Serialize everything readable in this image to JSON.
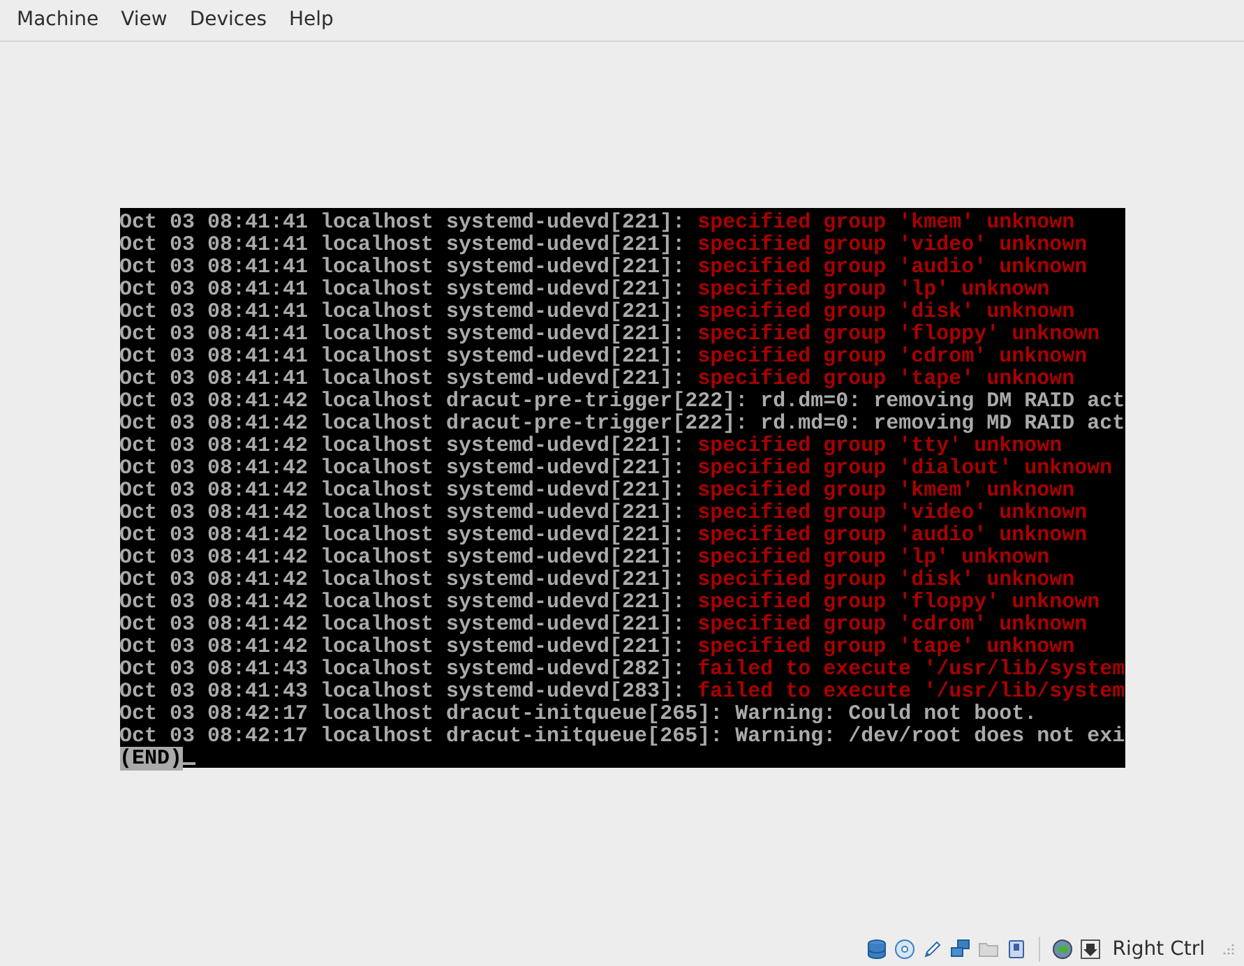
{
  "menu": [
    "Machine",
    "View",
    "Devices",
    "Help"
  ],
  "console": {
    "lines": [
      {
        "source": "Oct 03 08:41:41 localhost systemd-udevd[221]:",
        "message": "specified group 'kmem' unknown",
        "kind": "error"
      },
      {
        "source": "Oct 03 08:41:41 localhost systemd-udevd[221]:",
        "message": "specified group 'video' unknown",
        "kind": "error"
      },
      {
        "source": "Oct 03 08:41:41 localhost systemd-udevd[221]:",
        "message": "specified group 'audio' unknown",
        "kind": "error"
      },
      {
        "source": "Oct 03 08:41:41 localhost systemd-udevd[221]:",
        "message": "specified group 'lp' unknown",
        "kind": "error"
      },
      {
        "source": "Oct 03 08:41:41 localhost systemd-udevd[221]:",
        "message": "specified group 'disk' unknown",
        "kind": "error"
      },
      {
        "source": "Oct 03 08:41:41 localhost systemd-udevd[221]:",
        "message": "specified group 'floppy' unknown",
        "kind": "error"
      },
      {
        "source": "Oct 03 08:41:41 localhost systemd-udevd[221]:",
        "message": "specified group 'cdrom' unknown",
        "kind": "error"
      },
      {
        "source": "Oct 03 08:41:41 localhost systemd-udevd[221]:",
        "message": "specified group 'tape' unknown",
        "kind": "error"
      },
      {
        "source": "Oct 03 08:41:42 localhost dracut-pre-trigger[222]:",
        "message": "rd.dm=0: removing DM RAID act",
        "kind": "info"
      },
      {
        "source": "Oct 03 08:41:42 localhost dracut-pre-trigger[222]:",
        "message": "rd.md=0: removing MD RAID act",
        "kind": "info"
      },
      {
        "source": "Oct 03 08:41:42 localhost systemd-udevd[221]:",
        "message": "specified group 'tty' unknown",
        "kind": "error"
      },
      {
        "source": "Oct 03 08:41:42 localhost systemd-udevd[221]:",
        "message": "specified group 'dialout' unknown",
        "kind": "error"
      },
      {
        "source": "Oct 03 08:41:42 localhost systemd-udevd[221]:",
        "message": "specified group 'kmem' unknown",
        "kind": "error"
      },
      {
        "source": "Oct 03 08:41:42 localhost systemd-udevd[221]:",
        "message": "specified group 'video' unknown",
        "kind": "error"
      },
      {
        "source": "Oct 03 08:41:42 localhost systemd-udevd[221]:",
        "message": "specified group 'audio' unknown",
        "kind": "error"
      },
      {
        "source": "Oct 03 08:41:42 localhost systemd-udevd[221]:",
        "message": "specified group 'lp' unknown",
        "kind": "error"
      },
      {
        "source": "Oct 03 08:41:42 localhost systemd-udevd[221]:",
        "message": "specified group 'disk' unknown",
        "kind": "error"
      },
      {
        "source": "Oct 03 08:41:42 localhost systemd-udevd[221]:",
        "message": "specified group 'floppy' unknown",
        "kind": "error"
      },
      {
        "source": "Oct 03 08:41:42 localhost systemd-udevd[221]:",
        "message": "specified group 'cdrom' unknown",
        "kind": "error"
      },
      {
        "source": "Oct 03 08:41:42 localhost systemd-udevd[221]:",
        "message": "specified group 'tape' unknown",
        "kind": "error"
      },
      {
        "source": "Oct 03 08:41:43 localhost systemd-udevd[282]:",
        "message": "failed to execute '/usr/lib/system",
        "kind": "error"
      },
      {
        "source": "Oct 03 08:41:43 localhost systemd-udevd[283]:",
        "message": "failed to execute '/usr/lib/system",
        "kind": "error"
      },
      {
        "source": "Oct 03 08:42:17 localhost dracut-initqueue[265]:",
        "message": "Warning: Could not boot.",
        "kind": "info"
      },
      {
        "source": "Oct 03 08:42:17 localhost dracut-initqueue[265]:",
        "message": "Warning: /dev/root does not exi",
        "kind": "info"
      }
    ],
    "pager": "(END)"
  },
  "status_bar": {
    "host_key": "Right Ctrl"
  }
}
